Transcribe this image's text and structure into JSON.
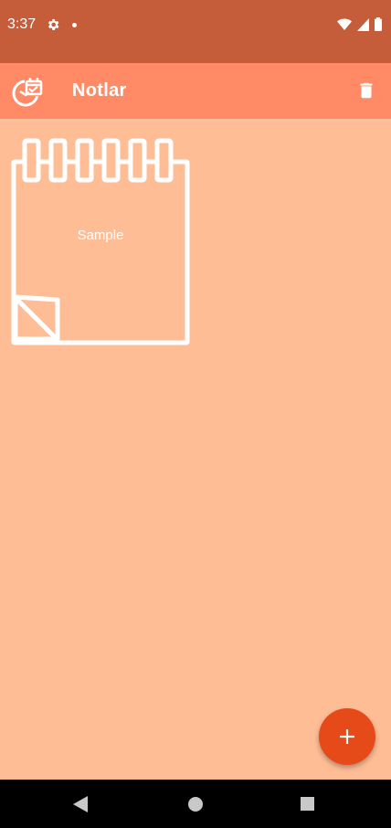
{
  "status_bar": {
    "time": "3:37",
    "icons": [
      "gear-icon",
      "notification-dot",
      "wifi-icon",
      "signal-icon",
      "battery-icon"
    ]
  },
  "app_bar": {
    "title": "Notlar",
    "logo_icon": "calendar-clock-icon",
    "action_icon": "trash-icon"
  },
  "notes": [
    {
      "title": "Sample"
    }
  ],
  "fab": {
    "icon": "plus-icon"
  },
  "nav_bar": {
    "icons": [
      "back-icon",
      "home-icon",
      "recents-icon"
    ]
  },
  "colors": {
    "status_bar": "#C55C3A",
    "app_bar": "#FF8A65",
    "background": "#FFBD96",
    "fab": "#E64A19",
    "nav_bar": "#000000"
  }
}
